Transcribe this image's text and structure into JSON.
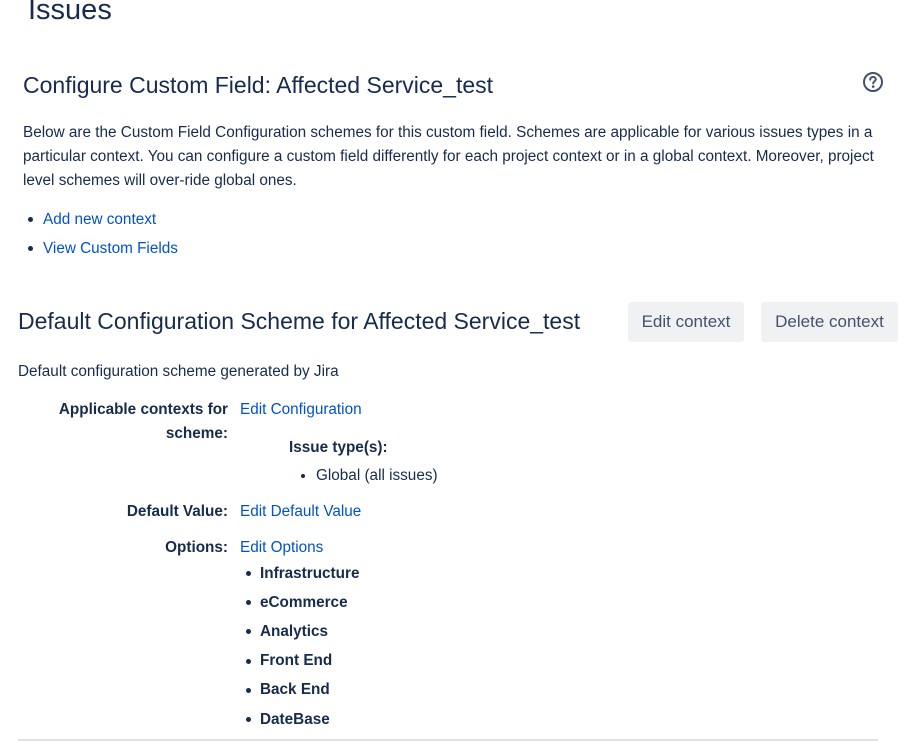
{
  "page": {
    "heading": "Issues"
  },
  "custom_field": {
    "title": "Configure Custom Field: Affected Service_test",
    "description": "Below are the Custom Field Configuration schemes for this custom field. Schemes are applicable for various issues types in a particular context. You can configure a custom field differently for each project context or in a global context. Moreover, project level schemes will over-ride global ones.",
    "links": [
      {
        "label": "Add new context"
      },
      {
        "label": "View Custom Fields"
      }
    ],
    "help_icon": "question-circle-icon"
  },
  "scheme": {
    "title": "Default Configuration Scheme for Affected Service_test",
    "edit_context_label": "Edit context",
    "delete_context_label": "Delete context",
    "description": "Default configuration scheme generated by Jira",
    "contexts_label_line1": "Applicable contexts for",
    "contexts_label_line2": "scheme:",
    "edit_configuration_label": "Edit Configuration",
    "issue_types_label": "Issue type(s):",
    "issue_types": [
      "Global (all issues)"
    ],
    "default_value_label": "Default Value:",
    "edit_default_value_label": "Edit Default Value",
    "options_label": "Options:",
    "edit_options_label": "Edit Options",
    "options": [
      "Infrastructure",
      "eCommerce",
      "Analytics",
      "Front End",
      "Back End",
      "DateBase"
    ]
  },
  "colors": {
    "text": "#172b4d",
    "link": "#0052cc",
    "button_bg": "#f0f1f3",
    "button_text": "#42526e"
  }
}
